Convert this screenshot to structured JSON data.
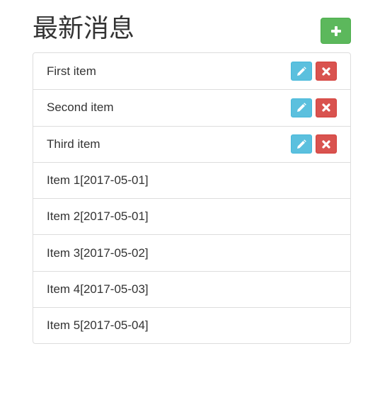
{
  "header": {
    "title": "最新消息"
  },
  "icons": {
    "add": "plus-icon",
    "edit": "pencil-icon",
    "delete": "close-icon"
  },
  "colors": {
    "add_button": "#5cb85c",
    "edit_button": "#5bc0de",
    "delete_button": "#d9534f",
    "border": "#dddddd",
    "text": "#333333"
  },
  "list": {
    "items": [
      {
        "label": "First item",
        "editable": true
      },
      {
        "label": "Second item",
        "editable": true
      },
      {
        "label": "Third item",
        "editable": true
      },
      {
        "label": "Item 1[2017-05-01]",
        "editable": false
      },
      {
        "label": "Item 2[2017-05-01]",
        "editable": false
      },
      {
        "label": "Item 3[2017-05-02]",
        "editable": false
      },
      {
        "label": "Item 4[2017-05-03]",
        "editable": false
      },
      {
        "label": "Item 5[2017-05-04]",
        "editable": false
      }
    ]
  }
}
